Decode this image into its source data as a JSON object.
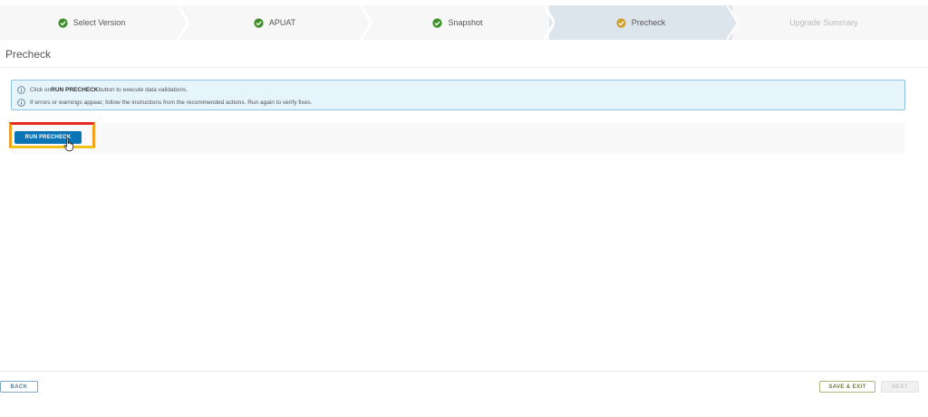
{
  "stepper": {
    "steps": [
      {
        "label": "Select Version",
        "state": "complete"
      },
      {
        "label": "APUAT",
        "state": "complete"
      },
      {
        "label": "Snapshot",
        "state": "complete"
      },
      {
        "label": "Precheck",
        "state": "active"
      },
      {
        "label": "Upgrade Summary",
        "state": "disabled"
      }
    ]
  },
  "page": {
    "title": "Precheck"
  },
  "alert": {
    "line1_prefix": "Click on ",
    "line1_bold": "RUN PRECHECK",
    "line1_suffix": " button to execute data validations.",
    "line2": "If errors or warnings appear, follow the instructions from the recommended actions. Run again to verify fixes."
  },
  "actions": {
    "run_precheck": "RUN PRECHECK"
  },
  "footer": {
    "back": "BACK",
    "save_exit": "SAVE & EXIT",
    "next": "NEXT"
  },
  "colors": {
    "complete": "#3f8f2a",
    "active": "#d1a02c",
    "primary": "#0a74b4",
    "alert_border": "#8fc2de",
    "alert_bg": "#e6f4fb",
    "highlight_red": "#e52a1f",
    "highlight_yellow": "#f2c21b"
  },
  "icons": {
    "step_complete": "check-circle-icon",
    "step_active": "check-circle-icon",
    "info": "info-circle-icon",
    "cursor": "hand-pointer-icon"
  }
}
